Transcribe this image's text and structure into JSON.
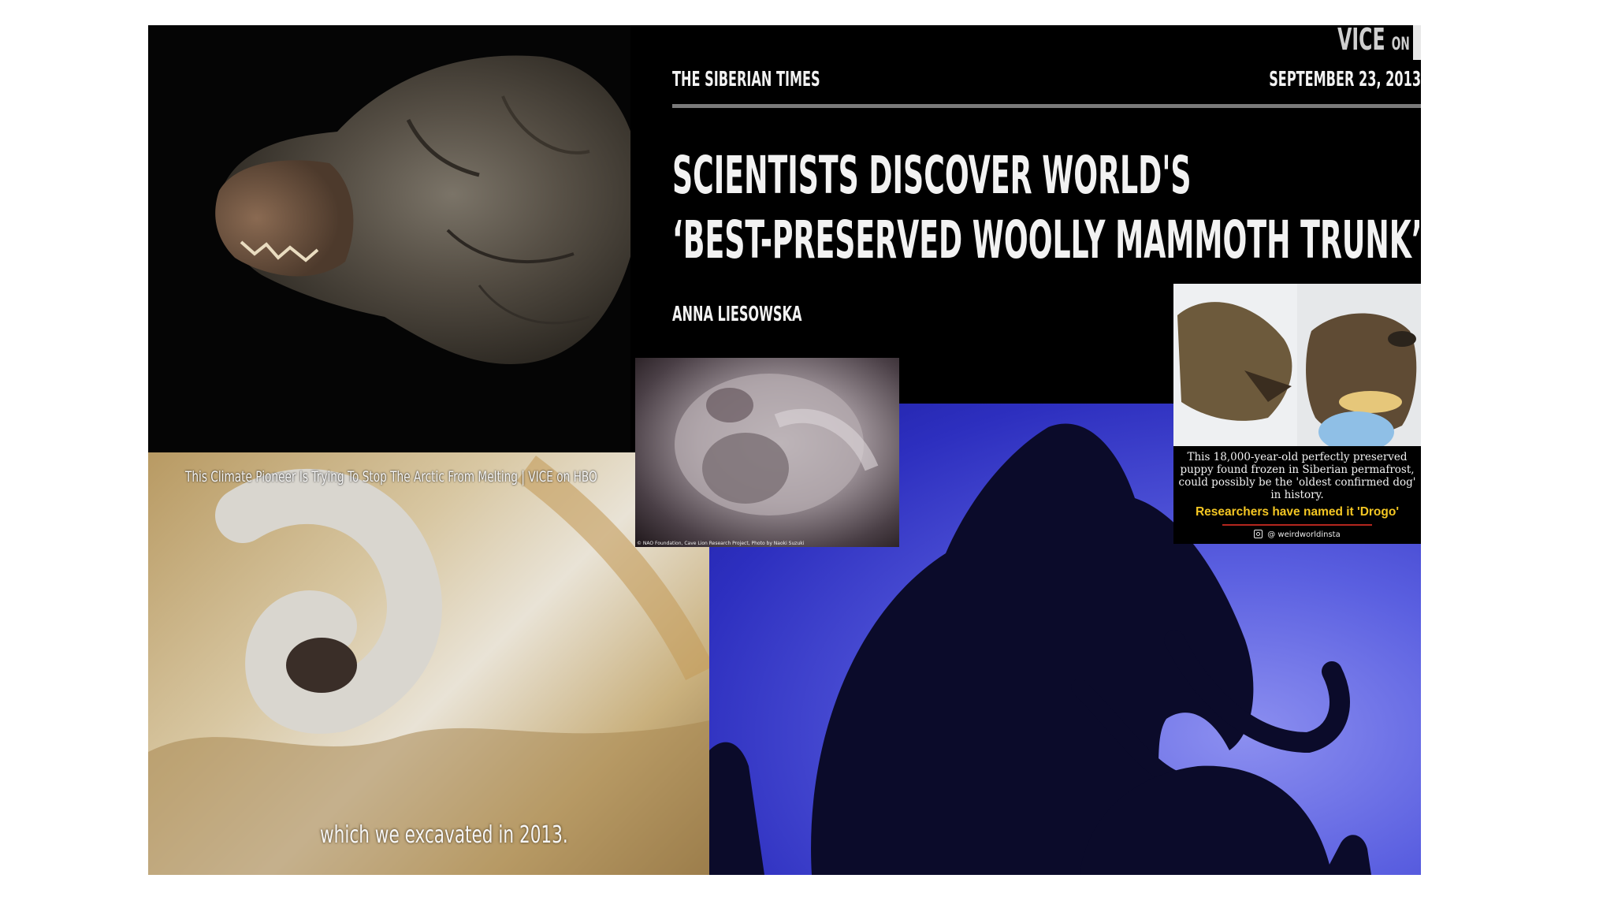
{
  "article": {
    "network_logo": "VICE",
    "network_logo_small": "ON",
    "publication": "THE SIBERIAN TIMES",
    "date": "SEPTEMBER 23, 2013",
    "headline_line1": "SCIENTISTS DISCOVER WORLD'S",
    "headline_line2": "‘BEST-PRESERVED WOOLLY MAMMOTH TRUNK’",
    "author": "ANNA LIESOWSKA"
  },
  "video": {
    "title": "This Climate Pioneer Is Trying To Stop The Arctic From Melting | VICE on HBO",
    "subtitle": "which we excavated in 2013."
  },
  "lion_photo": {
    "credit": "© NAO Foundation, Cave Lion Research Project, Photo by Naoki Suzuki"
  },
  "dog_card": {
    "caption": "This 18,000-year-old perfectly preserved puppy found frozen in Siberian permafrost, could possibly be the 'oldest confirmed dog' in history.",
    "highlight": "Researchers have named it 'Drogo'",
    "handle": "@ weirdworldinsta",
    "handle_icon": "instagram-icon"
  },
  "colors": {
    "background": "#ffffff",
    "header_bg": "#000000",
    "highlight_yellow": "#f3c623",
    "mammoth_sky": "#4a4fd8"
  }
}
